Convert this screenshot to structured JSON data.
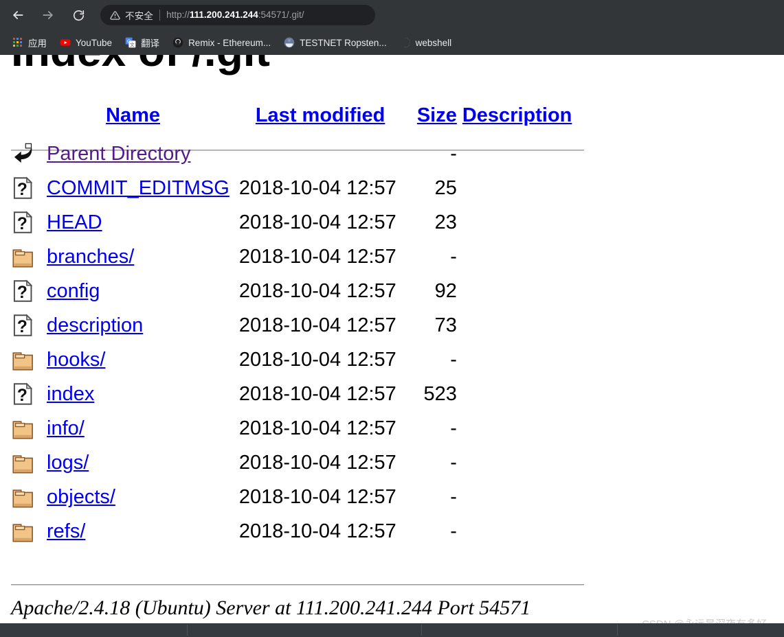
{
  "browser": {
    "nav": {
      "back_label": "Back",
      "forward_label": "Forward",
      "reload_label": "Reload"
    },
    "omnibox": {
      "security_label": "不安全",
      "url_scheme": "http://",
      "url_host": "111.200.241.244",
      "url_rest": ":54571/.git/",
      "full_url": "http://111.200.241.244:54571/.git/"
    },
    "bookmarks": [
      {
        "label": "应用",
        "icon": "apps-grid-icon"
      },
      {
        "label": "YouTube",
        "icon": "youtube-icon"
      },
      {
        "label": "翻译",
        "icon": "google-translate-icon"
      },
      {
        "label": "Remix - Ethereum...",
        "icon": "remix-icon"
      },
      {
        "label": "TESTNET Ropsten...",
        "icon": "metamask-icon"
      },
      {
        "label": "webshell",
        "icon": "globe-icon"
      }
    ]
  },
  "page": {
    "title": "Index of /.git",
    "columns": [
      {
        "key": "name",
        "label": "Name"
      },
      {
        "key": "modified",
        "label": "Last modified"
      },
      {
        "key": "size",
        "label": "Size"
      },
      {
        "key": "description",
        "label": "Description"
      }
    ],
    "rows": [
      {
        "icon": "back-arrow-icon",
        "name": "Parent Directory",
        "modified": "",
        "size": "-",
        "description": "",
        "kind": "parent"
      },
      {
        "icon": "unknown-file-icon",
        "name": "COMMIT_EDITMSG",
        "modified": "2018-10-04 12:57",
        "size": "25",
        "description": "",
        "kind": "file"
      },
      {
        "icon": "unknown-file-icon",
        "name": "HEAD",
        "modified": "2018-10-04 12:57",
        "size": "23",
        "description": "",
        "kind": "file"
      },
      {
        "icon": "folder-icon",
        "name": "branches/",
        "modified": "2018-10-04 12:57",
        "size": "-",
        "description": "",
        "kind": "dir"
      },
      {
        "icon": "unknown-file-icon",
        "name": "config",
        "modified": "2018-10-04 12:57",
        "size": "92",
        "description": "",
        "kind": "file"
      },
      {
        "icon": "unknown-file-icon",
        "name": "description",
        "modified": "2018-10-04 12:57",
        "size": "73",
        "description": "",
        "kind": "file"
      },
      {
        "icon": "folder-icon",
        "name": "hooks/",
        "modified": "2018-10-04 12:57",
        "size": "-",
        "description": "",
        "kind": "dir"
      },
      {
        "icon": "unknown-file-icon",
        "name": "index",
        "modified": "2018-10-04 12:57",
        "size": "523",
        "description": "",
        "kind": "file"
      },
      {
        "icon": "folder-icon",
        "name": "info/",
        "modified": "2018-10-04 12:57",
        "size": "-",
        "description": "",
        "kind": "dir"
      },
      {
        "icon": "folder-icon",
        "name": "logs/",
        "modified": "2018-10-04 12:57",
        "size": "-",
        "description": "",
        "kind": "dir"
      },
      {
        "icon": "folder-icon",
        "name": "objects/",
        "modified": "2018-10-04 12:57",
        "size": "-",
        "description": "",
        "kind": "dir"
      },
      {
        "icon": "folder-icon",
        "name": "refs/",
        "modified": "2018-10-04 12:57",
        "size": "-",
        "description": "",
        "kind": "dir"
      }
    ],
    "server_signature": "Apache/2.4.18 (Ubuntu) Server at 111.200.241.244 Port 54571"
  },
  "watermark": "CSDN @永远是深夜有多好。",
  "colors": {
    "chrome_bg": "#323639",
    "omnibox_bg": "#202124",
    "link": "#0000ee",
    "visited_link": "#551a8b",
    "folder_icon": "#f2c487",
    "page_bg": "#ffffff",
    "taskbar_bg": "#343a40"
  }
}
